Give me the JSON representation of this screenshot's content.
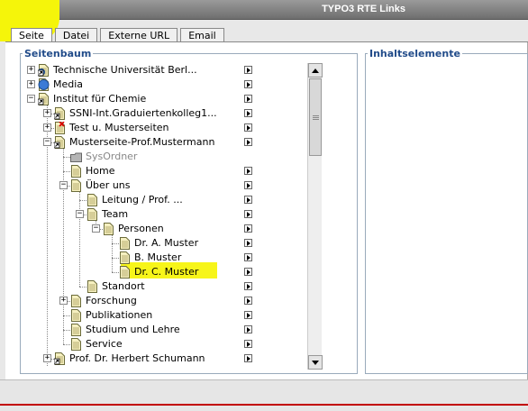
{
  "window": {
    "title": "TYPO3 RTE Links"
  },
  "tabs": [
    {
      "label": "Seite",
      "active": true
    },
    {
      "label": "Datei",
      "active": false
    },
    {
      "label": "Externe URL",
      "active": false
    },
    {
      "label": "Email",
      "active": false
    }
  ],
  "page_tree": {
    "legend": "Seitenbaum",
    "items": [
      {
        "label": "Technische Universität Berl...",
        "icon": "globe-page-icon",
        "expander": "plus"
      },
      {
        "label": "Media",
        "icon": "globe-icon",
        "expander": "plus"
      },
      {
        "label": "Institut für Chemie",
        "icon": "shortcut-page-icon",
        "expander": "minus"
      },
      {
        "label": "SSNI-Int.Graduiertenkolleg1...",
        "icon": "shortcut-page-icon",
        "expander": "plus"
      },
      {
        "label": "Test u. Musterseiten",
        "icon": "hidden-page-icon",
        "expander": "plus"
      },
      {
        "label": "Musterseite-Prof.Mustermann",
        "icon": "shortcut-page-icon",
        "expander": "minus"
      },
      {
        "label": "SysOrdner",
        "icon": "folder-icon",
        "expander": "none",
        "muted": true
      },
      {
        "label": "Home",
        "icon": "page-icon",
        "expander": "none"
      },
      {
        "label": "Über uns",
        "icon": "page-icon",
        "expander": "minus"
      },
      {
        "label": "Leitung / Prof. ...",
        "icon": "page-icon",
        "expander": "none"
      },
      {
        "label": "Team",
        "icon": "page-icon",
        "expander": "minus"
      },
      {
        "label": "Personen",
        "icon": "page-icon",
        "expander": "minus"
      },
      {
        "label": "Dr. A. Muster",
        "icon": "page-icon",
        "expander": "none"
      },
      {
        "label": "B. Muster",
        "icon": "page-icon",
        "expander": "none"
      },
      {
        "label": "Dr. C. Muster",
        "icon": "page-icon",
        "expander": "none",
        "highlight": true
      },
      {
        "label": "Standort",
        "icon": "page-icon",
        "expander": "none"
      },
      {
        "label": "Forschung",
        "icon": "page-icon",
        "expander": "plus"
      },
      {
        "label": "Publikationen",
        "icon": "page-icon",
        "expander": "none"
      },
      {
        "label": "Studium und Lehre",
        "icon": "page-icon",
        "expander": "none"
      },
      {
        "label": "Service",
        "icon": "page-icon",
        "expander": "none"
      },
      {
        "label": "Prof. Dr. Herbert Schumann",
        "icon": "shortcut-page-icon",
        "expander": "plus"
      }
    ]
  },
  "content_panel": {
    "legend": "Inhaltselemente"
  },
  "colors": {
    "highlight": "#f7f51a",
    "legend": "#224c8a",
    "titlebar": "#7a7a7a",
    "bottom_line": "#c20000"
  }
}
